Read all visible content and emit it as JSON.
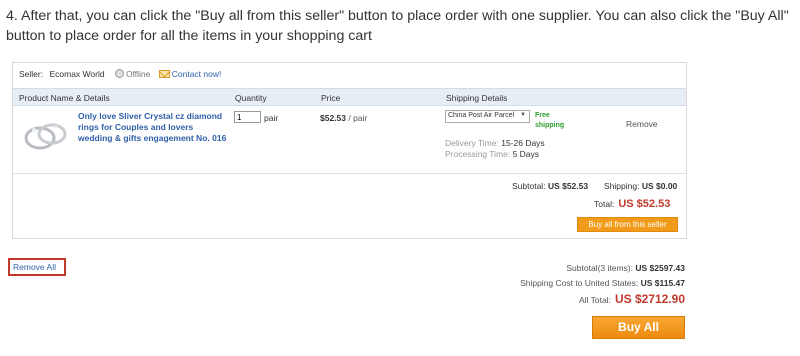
{
  "instruction": "4. After that, you can click the \"Buy all from this seller\" button to place order with one supplier. You can also click the \"Buy All\" button to place order for all the items in your shopping cart",
  "seller": {
    "label": "Seller:",
    "name": "Ecomax World",
    "status": "Offline",
    "contact": "Contact now!"
  },
  "table_headers": {
    "product": "Product Name & Details",
    "quantity": "Quantity",
    "price": "Price",
    "shipping": "Shipping Details"
  },
  "item": {
    "title": "Only love Sliver Crystal cz diamond rings for Couples and lovers wedding & gifts engagement No. 016",
    "quantity": "1",
    "quantity_unit": "pair",
    "price": "$52.53",
    "price_unit": "/ pair",
    "shipping_method": "China Post Air Parcel",
    "free_shipping": "Free shipping",
    "delivery_label": "Delivery Time:",
    "delivery_value": "15-26 Days",
    "processing_label": "Processing Time:",
    "processing_value": "5 Days",
    "remove": "Remove"
  },
  "seller_totals": {
    "subtotal_label": "Subtotal:",
    "subtotal_value": "US $52.53",
    "shipping_label": "Shipping:",
    "shipping_value": "US $0.00",
    "total_label": "Total:",
    "total_value": "US $52.53",
    "buy_seller_label": "Buy all from this seller"
  },
  "remove_all": "Remove All",
  "cart_totals": {
    "subtotal_label": "Subtotal(3 items):",
    "subtotal_value": "US $2597.43",
    "shipping_label": "Shipping Cost to United States:",
    "shipping_value": "US $115.47",
    "total_label": "All Total:",
    "total_value": "US $2712.90",
    "buy_all_label": "Buy All"
  },
  "colors": {
    "accent_orange": "#f29a1a",
    "total_red": "#c0392b",
    "link_blue": "#2f5fa8",
    "free_green": "#2e9e2e"
  }
}
